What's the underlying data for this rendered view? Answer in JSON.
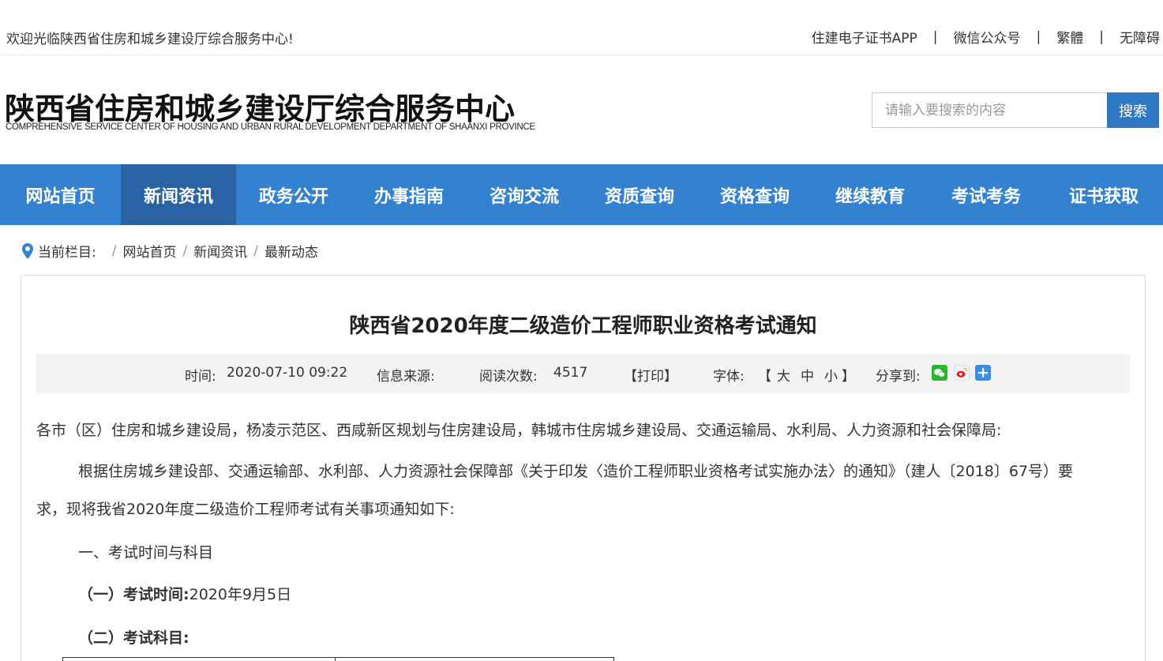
{
  "topbar": {
    "welcome": "欢迎光临陕西省住房和城乡建设厅综合服务中心!",
    "links": [
      "住建电子证书APP",
      "微信公众号",
      "繁體",
      "无障碍"
    ],
    "separator": "|"
  },
  "header": {
    "logo_cn": "陕西省住房和城乡建设厅综合服务中心",
    "logo_en": "COMPREHENSIVE SERVICE CENTER OF HOUSING AND URBAN RURAL DEVELOPMENT DEPARTMENT OF SHAANXI PROVINCE",
    "search_placeholder": "请输入要搜索的内容",
    "search_button": "搜索"
  },
  "nav": {
    "items": [
      "网站首页",
      "新闻资讯",
      "政务公开",
      "办事指南",
      "咨询交流",
      "资质查询",
      "资格查询",
      "继续教育",
      "考试考务",
      "证书获取"
    ],
    "active_index": 1
  },
  "breadcrumb": {
    "label": "当前栏目:",
    "items": [
      "网站首页",
      "新闻资讯",
      "最新动态"
    ],
    "separator": "/"
  },
  "article": {
    "title": "陕西省2020年度二级造价工程师职业资格考试通知",
    "meta": {
      "time_label": "时间:",
      "time_value": "2020-07-10 09:22",
      "source_label": "信息来源:",
      "reads_label": "阅读次数:",
      "reads_value": "4517",
      "print": "【打印】",
      "font_label": "字体:",
      "font_open": "【",
      "font_large": "大",
      "font_medium": "中",
      "font_small": "小",
      "font_close": "】",
      "share_label": "分享到:"
    },
    "p1": "各市（区）住房和城乡建设局，杨凌示范区、西咸新区规划与住房建设局，韩城市住房城乡建设局、交通运输局、水利局、人力资源和社会保障局:",
    "p2_line1": "根据住房城乡建设部、交通运输部、水利部、人力资源社会保障部《关于印发〈造价工程师职业资格考试实施办法〉的通知》（建人〔2018〕67号）要",
    "p2_line2": "求，现将我省2020年度二级造价工程师考试有关事项通知如下:",
    "section1": "一、考试时间与科目",
    "sub1_label": "（一）考试时间:",
    "sub1_value": "2020年9月5日",
    "sub2_label": "（二）考试科目:"
  },
  "colors": {
    "nav_bg": "#3381cf",
    "nav_active": "#2a63a3",
    "search_button": "#2f78c4"
  }
}
